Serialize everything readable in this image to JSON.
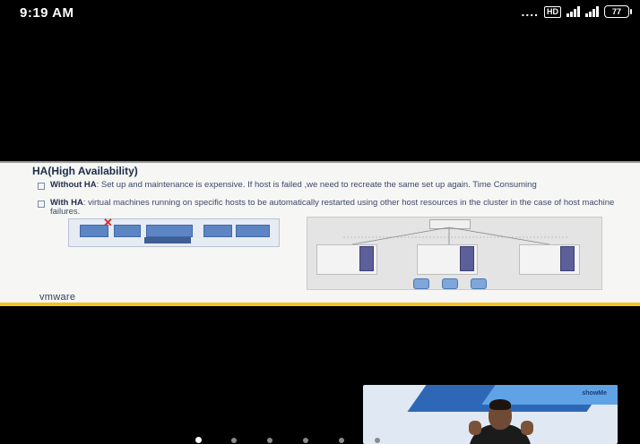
{
  "status_bar": {
    "time": "9:19 AM",
    "network_dots": "....",
    "hd_label": "HD",
    "battery": "77"
  },
  "slide": {
    "title": "HA(High Availability)",
    "bullets": [
      {
        "label": "Without HA",
        "text": ": Set up and maintenance is expensive. If host is failed ,we need  to recreate the same set up again. Time Consuming"
      },
      {
        "label": "With HA",
        "text": ": virtual machines running on specific hosts to be automatically restarted using other host resources in the cluster in the case of host machine failures."
      }
    ],
    "logo": "vmware",
    "accent_color": "#f3c31a"
  },
  "presenter": {
    "brand": "showMe"
  },
  "pager": {
    "count": 8,
    "active_index": 0
  }
}
